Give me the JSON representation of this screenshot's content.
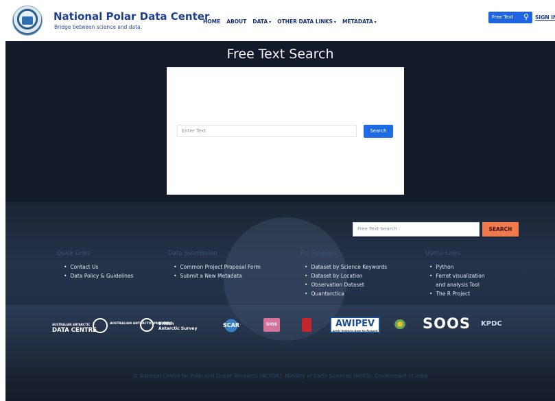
{
  "header": {
    "title": "National Polar Data Center",
    "subtitle": "Bridge between science and data.",
    "nav": [
      {
        "label": "HOME",
        "dropdown": false
      },
      {
        "label": "ABOUT",
        "dropdown": false
      },
      {
        "label": "DATA",
        "dropdown": true
      },
      {
        "label": "OTHER DATA LINKS",
        "dropdown": true
      },
      {
        "label": "METADATA",
        "dropdown": true
      }
    ],
    "search_label": "Free Text",
    "signin": "SIGN IN"
  },
  "main": {
    "title": "Free Text Search",
    "search_placeholder": "Enter Text",
    "search_button": "Search"
  },
  "footer": {
    "search_placeholder": "Free Text Search",
    "search_button": "SEARCH",
    "columns": [
      {
        "heading": "Quick Links",
        "items": [
          "Contact Us",
          "Data Policy & Guidelines"
        ]
      },
      {
        "heading": "Data Submission",
        "items": [
          "Common Project Proposal Form",
          "Submit a New Metadata"
        ]
      },
      {
        "heading": "For Scholars",
        "items": [
          "Dataset by Science Keywords",
          "Dataset by Location",
          "Observation Dataset",
          "Quantarctica"
        ]
      },
      {
        "heading": "Useful Links",
        "items": [
          "Python",
          "Ferret visualization",
          "and analysis Tool",
          "The R Project"
        ]
      }
    ],
    "logos": {
      "adc_line1": "AUSTRALIAN ANTARCTIC",
      "adc_line2": "DATA CENTRE",
      "aus_text": "AUSTRALIAN ANTARCTIC PROGRAM",
      "bas_line1": "British",
      "bas_line2": "Antarctic Survey",
      "scar": "SCAR",
      "sios": "SIOS",
      "awi": "AWIPEV",
      "awi_sub": "Arctic Research Base Ny-Ålesund",
      "soos": "SOOS",
      "kpdc": "KPDC"
    },
    "copyright": "© National Centre for Polar and Ocean Research (NCPOR), Ministry of Earth Sciences (MoES), Government of India"
  }
}
